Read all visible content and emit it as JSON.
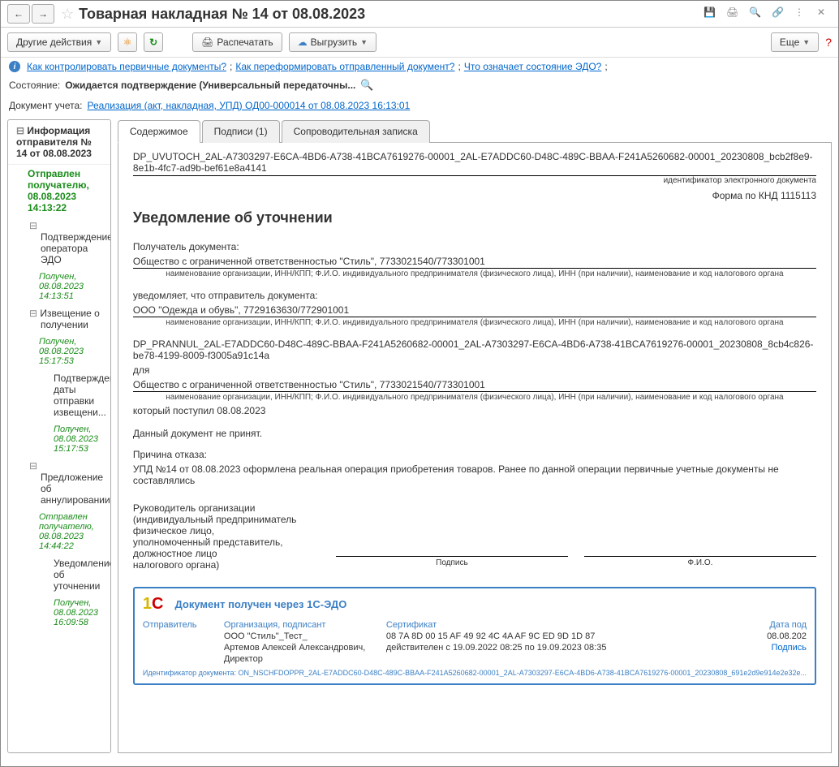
{
  "header": {
    "title": "Товарная накладная № 14 от 08.08.2023"
  },
  "toolbar": {
    "other_actions": "Другие действия",
    "print": "Распечатать",
    "upload": "Выгрузить",
    "more": "Еще"
  },
  "links": {
    "l1": "Как контролировать первичные документы?",
    "l2": "Как переформировать отправленный документ?",
    "l3": "Что означает состояние ЭДО?",
    "sep": ";"
  },
  "state": {
    "label": "Состояние:",
    "value": "Ожидается подтверждение (Универсальный передаточны..."
  },
  "doc_ref": {
    "label": "Документ учета:",
    "link": "Реализация (акт, накладная, УПД) ОД00-000014 от 08.08.2023 16:13:01"
  },
  "tree": {
    "header": "Информация отправителя № 14 от 08.08.2023",
    "sent": "Отправлен получателю, 08.08.2023 14:13:22",
    "i1": "Подтверждение оператора ЭДО",
    "s1": "Получен, 08.08.2023 14:13:51",
    "i2": "Извещение о получении",
    "s2": "Получен, 08.08.2023 15:17:53",
    "i3": "Подтверждение даты отправки извещени...",
    "s3": "Получен, 08.08.2023 15:17:53",
    "i4": "Предложение об аннулировании",
    "s4": "Отправлен получателю, 08.08.2023 14:44:22",
    "i5": "Уведомление об уточнении",
    "s5": "Получен, 08.08.2023 16:09:58"
  },
  "tabs": {
    "t1": "Содержимое",
    "t2": "Подписи (1)",
    "t3": "Сопроводительная записка"
  },
  "doc": {
    "id": "DP_UVUTOCH_2AL-A7303297-E6CA-4BD6-A738-41BCA7619276-00001_2AL-E7ADDC60-D48C-489C-BBAA-F241A5260682-00001_20230808_bcb2f8e9-8e1b-4fc7-ad9b-bef61e8a4141",
    "id_label": "идентификатор электронного документа",
    "form_code": "Форма по КНД 1115113",
    "title": "Уведомление об уточнении",
    "recipient_label": "Получатель документа:",
    "recipient": "Общество с ограниченной ответственностью \"Стиль\", 7733021540/773301001",
    "sub1": "наименование организации, ИНН/КПП; Ф.И.О. индивидуального предпринимателя (физического лица), ИНН (при наличии), наименование и код налогового органа",
    "notifies": "уведомляет, что отправитель документа:",
    "sender": "ООО \"Одежда и обувь\", 7729163630/772901001",
    "sub2": "наименование организации, ИНН/КПП; Ф.И.О. индивидуального предпринимателя (физического лица), ИНН (при наличии), наименование и код налогового органа",
    "file_ref": "DP_PRANNUL_2AL-E7ADDC60-D48C-489C-BBAA-F241A5260682-00001_2AL-A7303297-E6CA-4BD6-A738-41BCA7619276-00001_20230808_8cb4c826-be78-4199-8009-f3005a91c14a",
    "for_label": "для",
    "for_org": "Общество с ограниченной ответственностью \"Стиль\", 7733021540/773301001",
    "sub3": "наименование организации, ИНН/КПП; Ф.И.О. индивидуального предпринимателя (физического лица), ИНН (при наличии), наименование и код налогового органа",
    "received": "который поступил 08.08.2023",
    "rejected": "Данный документ не принят.",
    "reason_label": "Причина отказа:",
    "reason": "УПД №14 от 08.08.2023 оформлена реальная операция приобретения товаров. Ранее по данной операции первичные учетные документы не составлялись",
    "sig_block": "Руководитель  организации\n(индивидуальный предприниматель\nфизическое лицо,\nуполномоченный представитель,\nдолжностное лицо\nналогового органа)",
    "sig_sign": "Подпись",
    "sig_fio": "Ф.И.О."
  },
  "footer": {
    "title": "Документ получен через 1С-ЭДО",
    "sender_label": "Отправитель",
    "org_label": "Организация, подписант",
    "org": "ООО \"Стиль\"_Тест_",
    "signer": "Артемов Алексей Александрович,",
    "role": "Директор",
    "cert_label": "Сертификат",
    "cert": "08 7A 8D 00 15 AF 49 92 4C 4A AF 9C ED 9D 1D 87",
    "cert_valid": "действителен с 19.09.2022 08:25 по 19.09.2023 08:35",
    "date_label": "Дата под",
    "date": "08.08.202",
    "sign_link": "Подпись",
    "doc_id": "Идентификатор документа: ON_NSCHFDOPPR_2AL-E7ADDC60-D48C-489C-BBAA-F241A5260682-00001_2AL-A7303297-E6CA-4BD6-A738-41BCA7619276-00001_20230808_691e2d9e914e2e32e..."
  }
}
